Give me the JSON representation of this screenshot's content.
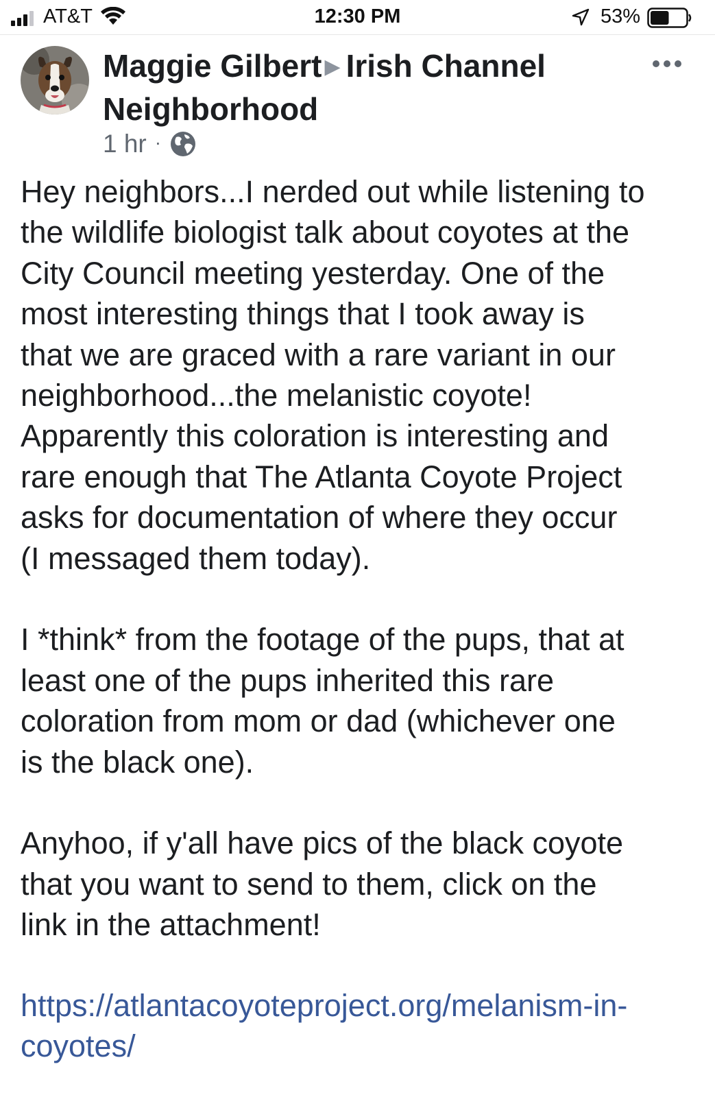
{
  "status_bar": {
    "carrier": "AT&T",
    "time": "12:30 PM",
    "battery": "53%",
    "battery_level": 0.53
  },
  "post": {
    "author": "Maggie Gilbert",
    "group": "Irish Channel Neighborhood",
    "group_lines": [
      "Irish Channel",
      "Neighborhood"
    ],
    "time": "1 hr",
    "separator": "·",
    "privacy_icon": "globe-icon",
    "more_icon": "more-icon",
    "paragraphs": [
      [
        "Hey neighbors...I nerded out while listening to",
        "the wildlife biologist talk about coyotes at the",
        "City Council meeting yesterday.  One of the",
        "most interesting things that I took away is",
        "that we are graced with a rare variant in our",
        "neighborhood...the melanistic coyote!",
        "Apparently this coloration is interesting and",
        "rare enough that The Atlanta Coyote Project",
        "asks for documentation of where they occur",
        "(I messaged them today)."
      ],
      [
        "I *think* from the footage of the pups, that at",
        "least one of the pups inherited this rare",
        "coloration from mom or dad (whichever one",
        "is the black one)."
      ],
      [
        "Anyhoo, if y'all have pics of the black coyote",
        "that you want to send to them, click on the",
        "link in the attachment!"
      ]
    ],
    "link_lines": [
      "https://atlantacoyoteproject.org/melanism-in-",
      "coyotes/"
    ]
  },
  "colors": {
    "text": "#1c1e21",
    "secondary": "#606770",
    "link": "#385898"
  }
}
